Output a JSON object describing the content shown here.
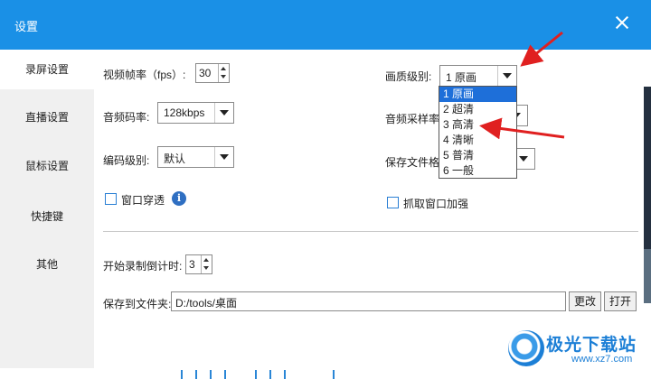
{
  "window": {
    "title": "设置"
  },
  "sidebar": {
    "items": [
      {
        "label": "录屏设置",
        "active": true
      },
      {
        "label": "直播设置",
        "active": false
      },
      {
        "label": "鼠标设置",
        "active": false
      },
      {
        "label": "快捷键",
        "active": false
      },
      {
        "label": "其他",
        "active": false
      }
    ]
  },
  "settings": {
    "fps": {
      "label": "视频帧率（fps）:",
      "value": "30"
    },
    "quality": {
      "label": "画质级别:",
      "value": "1 原画",
      "options": [
        "1 原画",
        "2 超清",
        "3 高清",
        "4 清晰",
        "5 普清",
        "6 一般"
      ]
    },
    "audio_bitrate": {
      "label": "音频码率:",
      "value": "128kbps"
    },
    "audio_samplerate": {
      "label": "音频采样率:"
    },
    "encode_level": {
      "label": "编码级别:",
      "value": "默认"
    },
    "save_format": {
      "label": "保存文件格式:"
    },
    "window_pierce": {
      "label": "窗口穿透",
      "checked": false
    },
    "capture_enhance": {
      "label": "抓取窗口加强",
      "checked": false
    },
    "countdown": {
      "label": "开始录制倒计时:",
      "value": "3"
    },
    "save_folder": {
      "label": "保存到文件夹:",
      "value": "D:/tools/桌面",
      "change_label": "更改",
      "open_label": "打开"
    }
  },
  "watermark": {
    "brand": "极光下载站",
    "url": "www.xz7.com"
  },
  "colors": {
    "accent": "#1a90e6",
    "selected": "#1e6fd9",
    "arrow": "#e02020"
  }
}
